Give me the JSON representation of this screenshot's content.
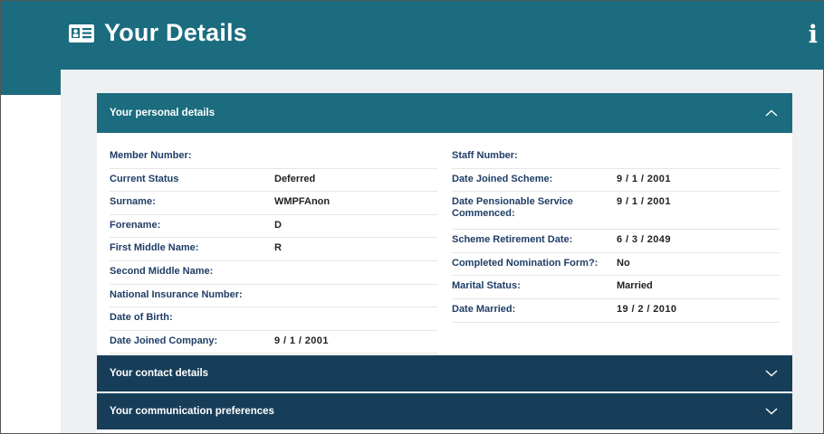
{
  "header": {
    "title": "Your Details",
    "icon": "id-card-icon",
    "info_icon": "info-icon",
    "info_label": "i",
    "bg_color": "#1b6c7e"
  },
  "panels": {
    "personal": {
      "label": "Your personal details",
      "expanded": true
    },
    "contact": {
      "label": "Your contact details",
      "expanded": false
    },
    "communication": {
      "label": "Your communication preferences",
      "expanded": false
    }
  },
  "personal_left": [
    {
      "label": "Member Number:",
      "value": ""
    },
    {
      "label": "Current Status",
      "value": "Deferred"
    },
    {
      "label": "Surname:",
      "value": "WMPFAnon"
    },
    {
      "label": "Forename:",
      "value": "D"
    },
    {
      "label": "First Middle Name:",
      "value": "R"
    },
    {
      "label": "Second Middle Name:",
      "value": ""
    },
    {
      "label": "National Insurance Number:",
      "value": ""
    },
    {
      "label": "Date of Birth:",
      "value": ""
    },
    {
      "label": "Date Joined Company:",
      "value": "9 / 1 / 2001"
    }
  ],
  "personal_right": [
    {
      "label": "Staff Number:",
      "value": ""
    },
    {
      "label": "Date Joined Scheme:",
      "value": "9 / 1 / 2001"
    },
    {
      "label": "Date Pensionable Service Commenced:",
      "value": "9 / 1 / 2001"
    },
    {
      "label": "Scheme Retirement Date:",
      "value": "6 / 3 / 2049"
    },
    {
      "label": "Completed Nomination Form?:",
      "value": "No"
    },
    {
      "label": "Marital Status:",
      "value": "Married"
    },
    {
      "label": "Date Married:",
      "value": "19 / 2 / 2010"
    }
  ]
}
